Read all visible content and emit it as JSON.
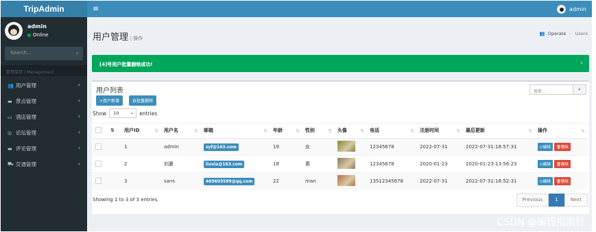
{
  "app": {
    "brand": "TripAdmin",
    "menu_toggle": "≡"
  },
  "topbar": {
    "user": "admin"
  },
  "sidebar": {
    "user_name": "admin",
    "status": "Online",
    "search_placeholder": "Search...",
    "header": "管理菜单 | Management",
    "items": [
      {
        "label": "用户管理",
        "icon": "users-icon",
        "glyph": "👥"
      },
      {
        "label": "景点管理",
        "icon": "book-icon",
        "glyph": "▬"
      },
      {
        "label": "酒店管理",
        "icon": "bed-icon",
        "glyph": "▭"
      },
      {
        "label": "论坛管理",
        "icon": "comments-icon",
        "glyph": "◎"
      },
      {
        "label": "评论管理",
        "icon": "file-icon",
        "glyph": "▬"
      },
      {
        "label": "交通管理",
        "icon": "car-icon",
        "glyph": "⛟"
      }
    ]
  },
  "page": {
    "title": "用户管理",
    "subtitle": "操作",
    "breadcrumb": [
      "Operate",
      "Users"
    ]
  },
  "alert": {
    "message": "[4]号用户批量删除成功!",
    "close": "×"
  },
  "box": {
    "title": "用户列表",
    "add_button": "+用户新增",
    "batch_delete_button": "自批量删除",
    "search_placeholder": "搜索...",
    "search_icon": "search-icon",
    "show_label": "Show",
    "entries_value": "10",
    "entries_label": "entries"
  },
  "table": {
    "columns": [
      "",
      "",
      "用户ID",
      "用户名",
      "邮箱",
      "年龄",
      "性别",
      "头像",
      "电话",
      "注册时间",
      "最后更新",
      "操作"
    ],
    "rows": [
      {
        "id": "1",
        "name": "admin",
        "email": "zyf@163.com",
        "age": "19",
        "gender": "女",
        "phone": "12345678",
        "registered": "2022-07-31",
        "updated": "2022-07-31:18:57:31",
        "thumb_color": "#7c8a3a"
      },
      {
        "id": "2",
        "name": "刘夏",
        "email": "liuxia@163.com",
        "age": "18",
        "gender": "男",
        "phone": "12345678",
        "registered": "2020-01-23",
        "updated": "2020-01-23:13:56:23",
        "thumb_color": "#8a7a6a"
      },
      {
        "id": "3",
        "name": "sans",
        "email": "469603589@qq.com",
        "age": "22",
        "gender": "man",
        "phone": "13512345678",
        "registered": "2022-07-31",
        "updated": "2022-07-31:18:52:31",
        "thumb_color": "#b07050"
      }
    ],
    "edit_label": "☑编辑",
    "delete_label": "🗑删除"
  },
  "pagination": {
    "info": "Showing 1 to 3 of 3 entries",
    "previous": "Previous",
    "current": "1",
    "next": "Next"
  },
  "watermark": "CSDN @编程指南针",
  "colors": {
    "primary": "#3c8dbc",
    "sidebar": "#222d32",
    "success": "#00a65a",
    "danger": "#dd4b39"
  }
}
